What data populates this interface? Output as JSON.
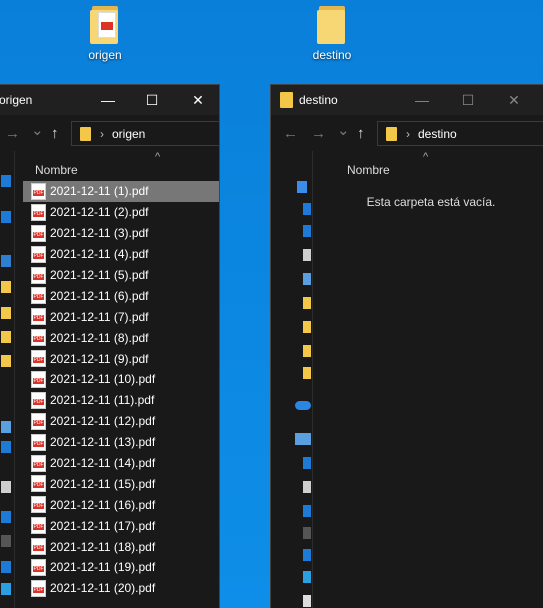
{
  "desktop": {
    "icons": [
      {
        "label": "origen"
      },
      {
        "label": "destino"
      }
    ]
  },
  "left_window": {
    "title": "origen",
    "address": "origen",
    "column_header": "Nombre",
    "files": [
      "2021-12-11 (1).pdf",
      "2021-12-11 (2).pdf",
      "2021-12-11 (3).pdf",
      "2021-12-11 (4).pdf",
      "2021-12-11 (5).pdf",
      "2021-12-11 (6).pdf",
      "2021-12-11 (7).pdf",
      "2021-12-11 (8).pdf",
      "2021-12-11 (9).pdf",
      "2021-12-11 (10).pdf",
      "2021-12-11 (11).pdf",
      "2021-12-11 (12).pdf",
      "2021-12-11 (13).pdf",
      "2021-12-11 (14).pdf",
      "2021-12-11 (15).pdf",
      "2021-12-11 (16).pdf",
      "2021-12-11 (17).pdf",
      "2021-12-11 (18).pdf",
      "2021-12-11 (19).pdf",
      "2021-12-11 (20).pdf"
    ],
    "selected_index": 0
  },
  "right_window": {
    "title": "destino",
    "address": "destino",
    "column_header": "Nombre",
    "empty_message": "Esta carpeta está vacía."
  },
  "glyphs": {
    "minimize": "—",
    "maximize": "☐",
    "close": "✕",
    "back": "←",
    "forward": "→",
    "recent": "⌄",
    "up": "↑",
    "chevron": "›",
    "sort": "^",
    "pdf": "PDF"
  },
  "colors": {
    "desktop": "#0b86e0",
    "window_bg": "#191919",
    "selected_row": "#777777",
    "folder": "#f3c748",
    "pdf_red": "#d9342b"
  }
}
